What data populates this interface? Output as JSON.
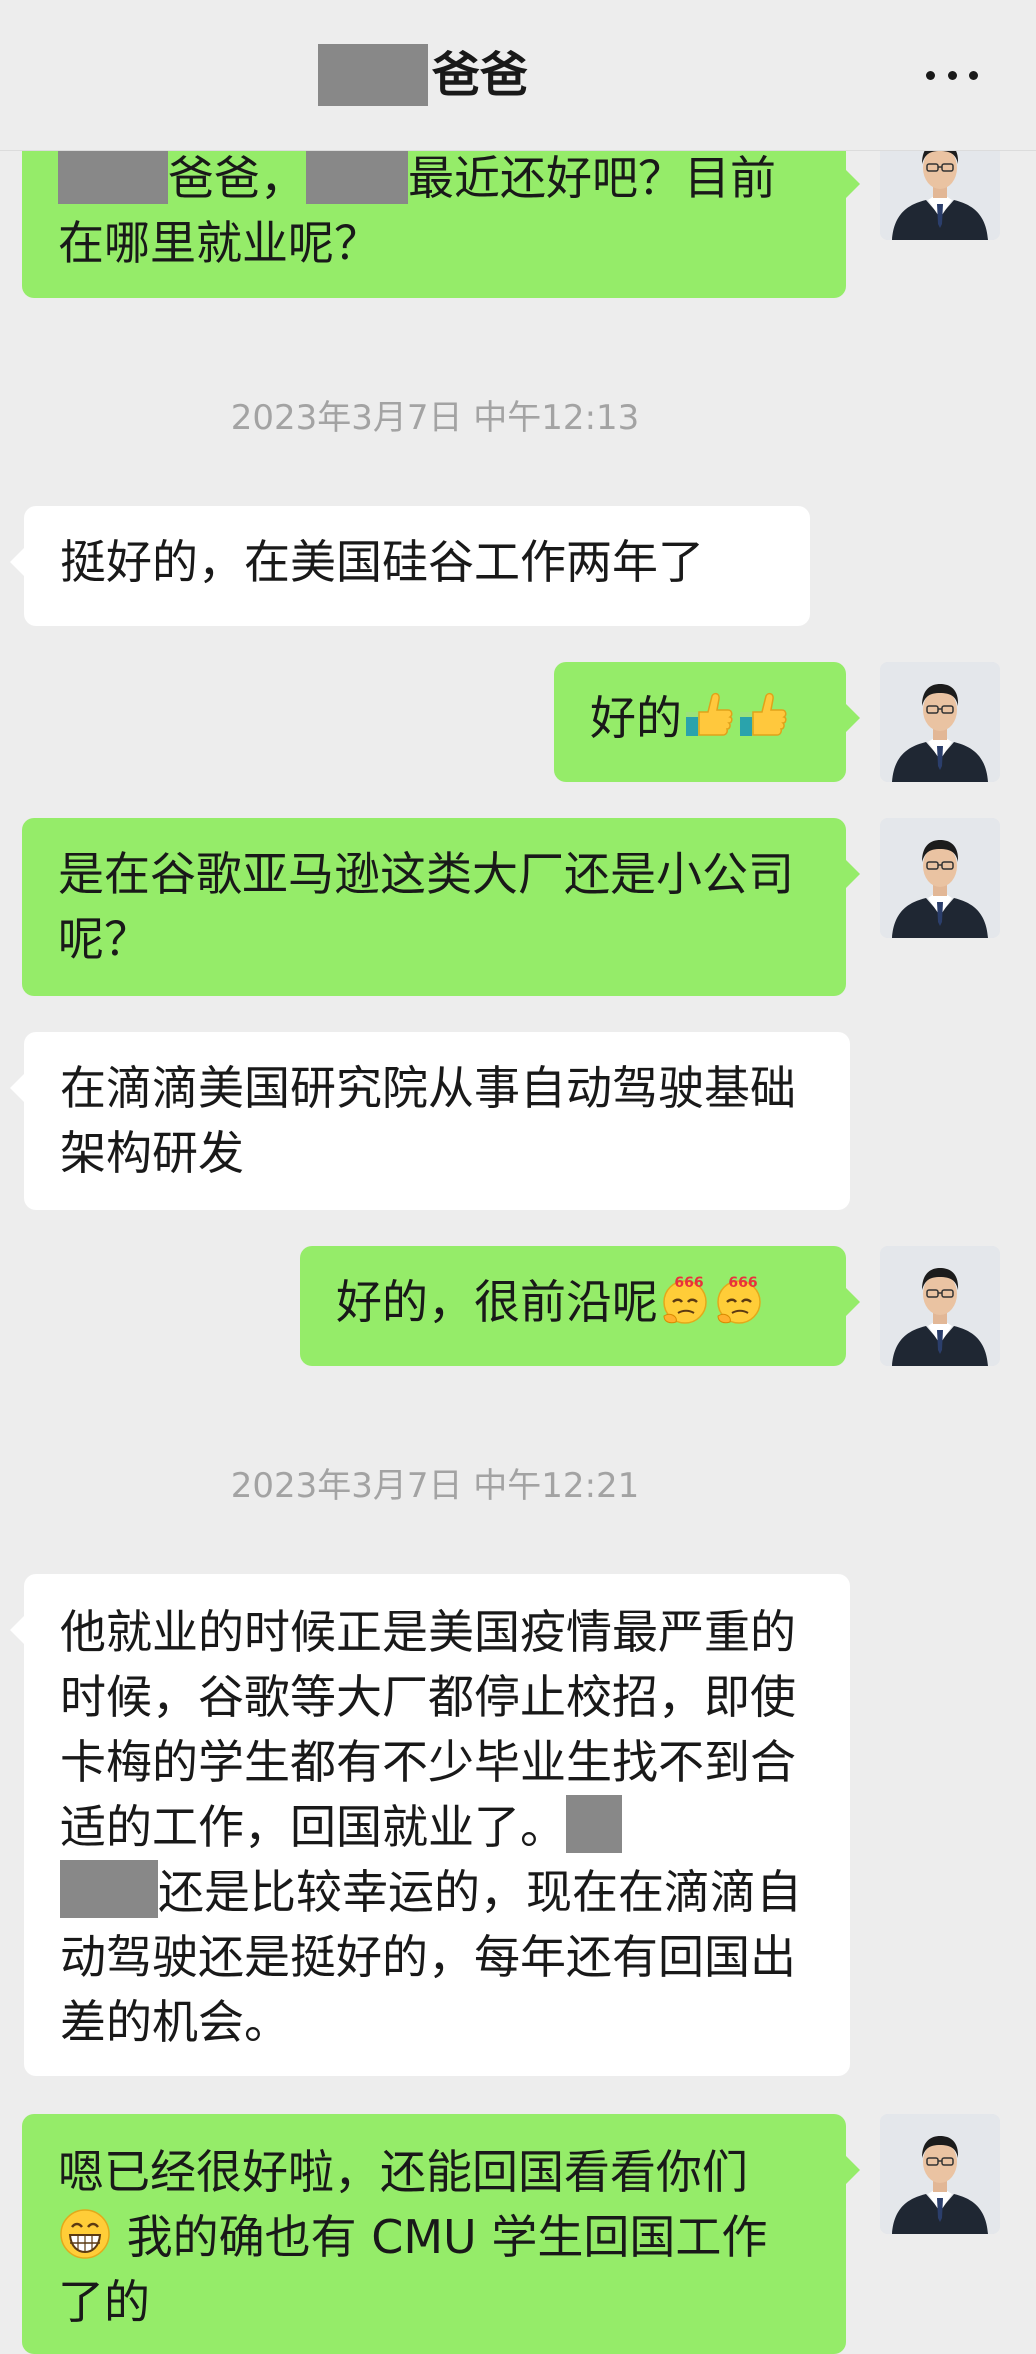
{
  "header": {
    "title": "爸爸",
    "title_redacted": true
  },
  "timestamps": [
    "2023年3月7日 中午12:13",
    "2023年3月7日 中午12:21"
  ],
  "messages": [
    {
      "from": "me",
      "segments": [
        "爸爸，",
        "最近还好吧？目前在哪里就业呢？"
      ]
    },
    {
      "from": "them",
      "text": "挺好的，在美国硅谷工作两年了"
    },
    {
      "from": "me",
      "text": "好的",
      "emoji": [
        "thumbs-up-emoji",
        "thumbs-up-emoji"
      ]
    },
    {
      "from": "me",
      "text": "是在谷歌亚马逊这类大厂还是小公司呢？"
    },
    {
      "from": "them",
      "text": "在滴滴美国研究院从事自动驾驶基础架构研发"
    },
    {
      "from": "me",
      "text": "好的，很前沿呢",
      "emoji": [
        "666-emoji",
        "666-emoji"
      ]
    },
    {
      "from": "them",
      "segments": [
        "他就业的时候正是美国疫情最严重的时候，谷歌等大厂都停止校招，即使卡梅的学生都有不少毕业生找不到合适的工作，回国就业了。",
        "还是比较幸运的，现在在滴滴自动驾驶还是挺好的，每年还有回国出差的机会。"
      ]
    },
    {
      "from": "me",
      "segments": [
        "嗯已经很好啦，还能回国看看你们",
        " 我的确也有 CMU 学生回国工作了的"
      ],
      "emoji": [
        "grin-emoji"
      ]
    }
  ],
  "emoji_labels": {
    "six": "666"
  },
  "colors": {
    "background": "#ededed",
    "my_bubble": "#95ec69",
    "their_bubble": "#ffffff",
    "timestamp_text": "#a3a3a3",
    "redaction": "#888888"
  },
  "icons": [
    "more-icon",
    "avatar"
  ]
}
